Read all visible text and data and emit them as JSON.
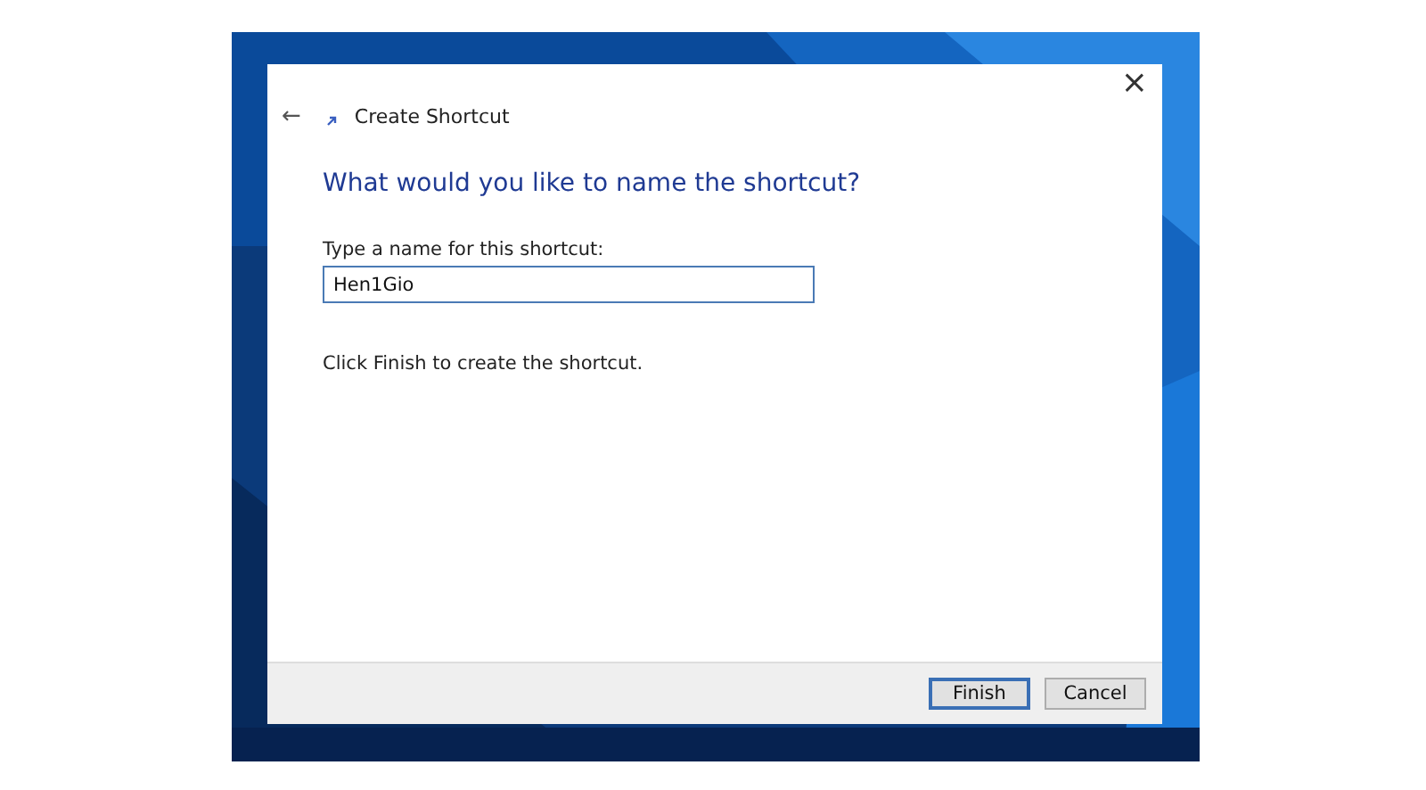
{
  "dialog": {
    "close": "×",
    "back": "←",
    "title": "Create Shortcut",
    "heading": "What would you like to name the shortcut?",
    "field_label": "Type a name for this shortcut:",
    "field_value": "Hen1Gio",
    "hint": "Click Finish to create the shortcut."
  },
  "buttons": [
    {
      "label": "Finish",
      "default": true
    },
    {
      "label": "Cancel",
      "default": false
    }
  ]
}
